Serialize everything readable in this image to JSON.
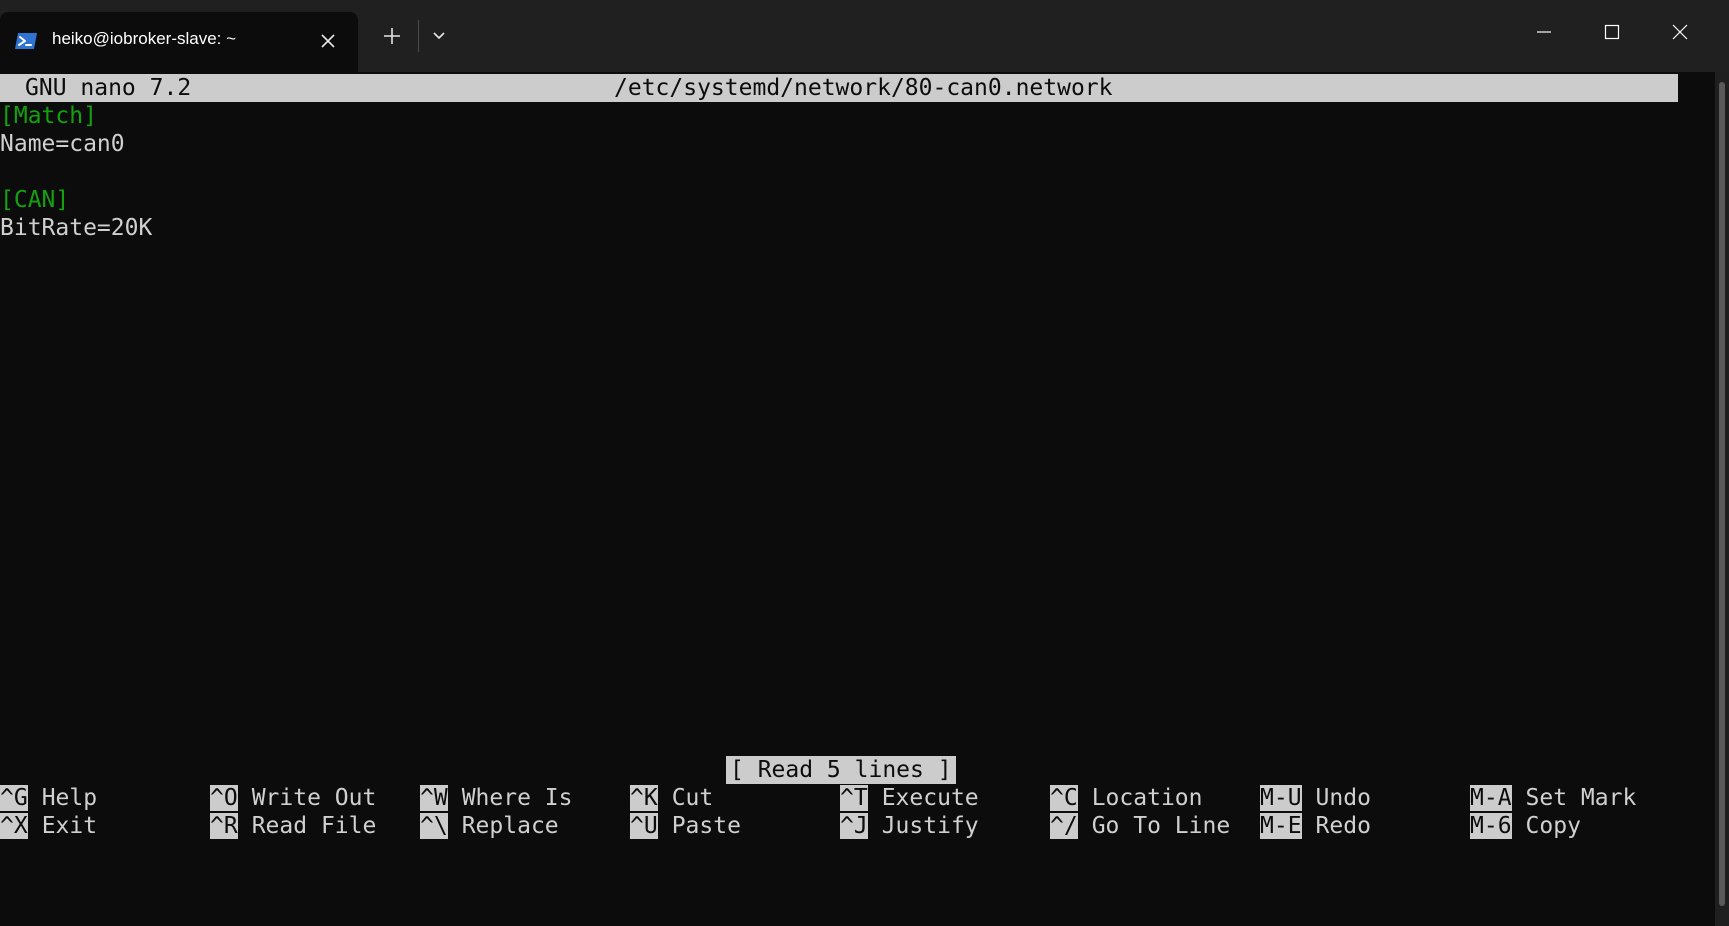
{
  "window": {
    "tab_title": "heiko@iobroker-slave: ~",
    "tab_icon": "powershell-icon",
    "new_tab_label": "+"
  },
  "colors": {
    "terminal_bg": "#0c0c0c",
    "section_green": "#13a10e",
    "bar_gray": "#cccccc"
  },
  "nano": {
    "version": "GNU nano 7.2",
    "filename": "/etc/systemd/network/80-can0.network",
    "lines": [
      {
        "text": "[Match]",
        "type": "section"
      },
      {
        "text": "Name=can0",
        "type": "plain"
      },
      {
        "text": "",
        "type": "plain"
      },
      {
        "text": "[CAN]",
        "type": "section"
      },
      {
        "text": "BitRate=20K",
        "type": "plain"
      }
    ],
    "status": "[ Read 5 lines ]",
    "shortcuts_row1": [
      {
        "key": "^G",
        "label": "Help"
      },
      {
        "key": "^O",
        "label": "Write Out"
      },
      {
        "key": "^W",
        "label": "Where Is"
      },
      {
        "key": "^K",
        "label": "Cut"
      },
      {
        "key": "^T",
        "label": "Execute"
      },
      {
        "key": "^C",
        "label": "Location"
      },
      {
        "key": "M-U",
        "label": "Undo"
      },
      {
        "key": "M-A",
        "label": "Set Mark"
      }
    ],
    "shortcuts_row2": [
      {
        "key": "^X",
        "label": "Exit"
      },
      {
        "key": "^R",
        "label": "Read File"
      },
      {
        "key": "^\\",
        "label": "Replace"
      },
      {
        "key": "^U",
        "label": "Paste"
      },
      {
        "key": "^J",
        "label": "Justify"
      },
      {
        "key": "^/",
        "label": "Go To Line"
      },
      {
        "key": "M-E",
        "label": "Redo"
      },
      {
        "key": "M-6",
        "label": "Copy"
      }
    ]
  }
}
